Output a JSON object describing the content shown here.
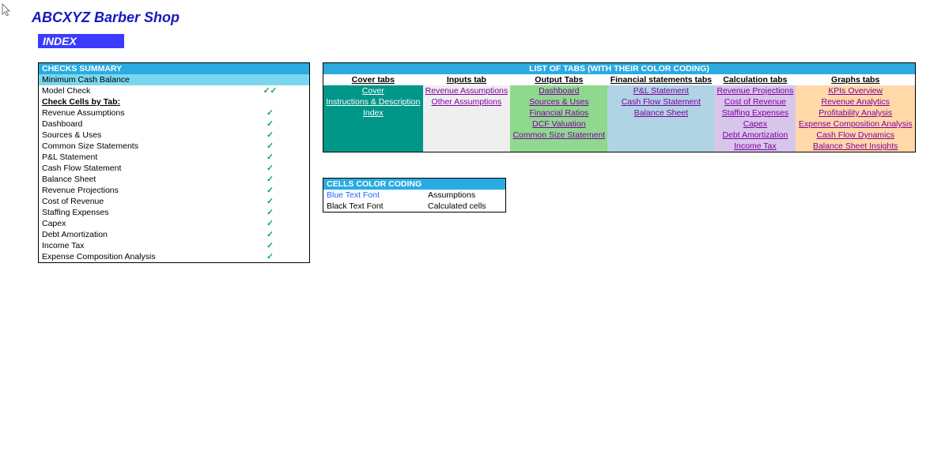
{
  "page": {
    "title": "ABCXYZ Barber Shop",
    "index_label": "INDEX"
  },
  "checks": {
    "header": "CHECKS  SUMMARY",
    "rows": [
      {
        "label": "Minimum Cash Balance",
        "mark": "",
        "highlight": true
      },
      {
        "label": "Model Check",
        "mark": "✓✓"
      },
      {
        "label": "Check Cells by Tab:",
        "mark": "",
        "subheader": true
      },
      {
        "label": "Revenue Assumptions",
        "mark": "✓"
      },
      {
        "label": "Dashboard",
        "mark": "✓"
      },
      {
        "label": "Sources & Uses",
        "mark": "✓"
      },
      {
        "label": "Common Size Statements",
        "mark": "✓"
      },
      {
        "label": "P&L Statement",
        "mark": "✓"
      },
      {
        "label": "Cash Flow Statement",
        "mark": "✓"
      },
      {
        "label": "Balance Sheet",
        "mark": "✓"
      },
      {
        "label": "Revenue Projections",
        "mark": "✓"
      },
      {
        "label": "Cost of Revenue",
        "mark": "✓"
      },
      {
        "label": "Staffing Expenses",
        "mark": "✓"
      },
      {
        "label": "Capex",
        "mark": "✓"
      },
      {
        "label": "Debt Amortization",
        "mark": "✓"
      },
      {
        "label": "Income Tax",
        "mark": "✓"
      },
      {
        "label": "Expense Composition Analysis",
        "mark": "✓"
      }
    ]
  },
  "tabs": {
    "title": "LIST OF TABS (WITH THEIR COLOR CODING)",
    "columns": [
      "Cover tabs",
      "Inputs tab",
      "Output Tabs",
      "Financial statements tabs",
      "Calculation tabs",
      "Graphs tabs"
    ],
    "grid": [
      [
        "Cover",
        "Revenue Assumptions",
        "Dashboard",
        "P&L Statement",
        "Revenue Projections",
        "KPIs Overview"
      ],
      [
        "Instructions & Description",
        "Other Assumptions",
        "Sources & Uses",
        "Cash Flow Statement",
        "Cost of Revenue",
        "Revenue Analytics"
      ],
      [
        "Index",
        "",
        "Financial Ratios",
        "Balance Sheet",
        "Staffing Expenses",
        "Profitability Analysis"
      ],
      [
        "",
        "",
        "DCF Valuation",
        "",
        "Capex ",
        "Expense Composition Analysis"
      ],
      [
        "",
        "",
        "Common Size Statement",
        "",
        "Debt Amortization",
        "Cash Flow Dynamics"
      ],
      [
        "",
        "",
        "",
        "",
        "Income Tax",
        "Balance Sheet Insights"
      ]
    ]
  },
  "coding": {
    "header": "CELLS COLOR CODING",
    "rows": [
      {
        "label": "Blue Text Font",
        "meaning": "Assumptions",
        "blue": true
      },
      {
        "label": "Black Text Font",
        "meaning": "Calculated cells"
      }
    ]
  }
}
